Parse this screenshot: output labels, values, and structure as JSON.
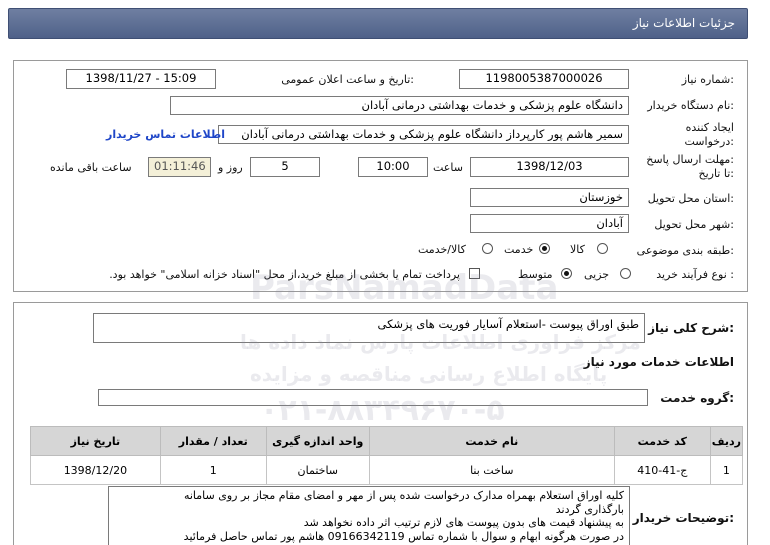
{
  "header": {
    "title": "جزئیات اطلاعات نیاز"
  },
  "form": {
    "need_number_label": "شماره نیاز:",
    "need_number": "1198005387000026",
    "announce_label": "تاریخ و ساعت اعلان عمومی:",
    "announce_value": "1398/11/27 - 15:09",
    "buyer_label": "نام دستگاه خریدار:",
    "buyer_value": "دانشگاه علوم پزشکی و خدمات بهداشتی درمانی آبادان",
    "creator_label_1": "ایجاد کننده",
    "creator_label_2": "درخواست:",
    "creator_value": "سمیر هاشم پور کارپرداز دانشگاه علوم پزشکی و خدمات بهداشتی درمانی آبادان",
    "contact_link": "اطلاعات تماس خریدار",
    "deadline_label_1": "مهلت ارسال پاسخ:",
    "deadline_label_2": "تا تاریخ:",
    "deadline_date": "1398/12/03",
    "time_label": "ساعت",
    "deadline_time": "10:00",
    "days_value": "5",
    "days_label": "روز و",
    "remaining_value": "01:11:46",
    "remaining_label": "ساعت باقی مانده",
    "province_label": "استان محل تحویل:",
    "province_value": "خوزستان",
    "city_label": "شهر محل تحویل:",
    "city_value": "آبادان",
    "category_label": "طبقه بندی موضوعی:",
    "category_options": [
      "کالا",
      "خدمت",
      "کالا/خدمت"
    ],
    "category_selected": "خدمت",
    "process_label": "نوع فرآیند خرید :",
    "process_options": [
      "جزیی",
      "متوسط"
    ],
    "process_selected": "متوسط",
    "payment_note": "پرداخت تمام یا بخشی از مبلغ خرید،از محل \"اسناد خزانه اسلامی\" خواهد بود."
  },
  "summary": {
    "label": "شرح کلی نیاز:",
    "value": "طبق اوراق پیوست -استعلام  آسایار فوریت های پزشکی",
    "services_heading": "اطلاعات خدمات مورد نیاز",
    "group_label": "گروه خدمت:",
    "group_value": ""
  },
  "table": {
    "headers": [
      "ردیف",
      "کد خدمت",
      "نام خدمت",
      "واحد اندازه گیری",
      "تعداد / مقدار",
      "تاریخ نیاز"
    ],
    "rows": [
      [
        "1",
        "ج-41-410",
        "ساخت بنا",
        "ساختمان",
        "1",
        "1398/12/20"
      ]
    ]
  },
  "notes": {
    "label": "توضیحات خریدار:",
    "lines": [
      "کلیه اوراق استعلام بهمراه مدارک درخواست شده پس از مهر و امضای مقام مجاز بر روی سامانه",
      "بارگذاری گردند",
      "به پیشنهاد قیمت های بدون پیوست های لازم ترتیب اثر داده نخواهد شد",
      "در صورت هرگونه ابهام و سوال با شماره تماس 09166342119 هاشم پور تماس حاصل فرمائید"
    ]
  },
  "watermark": {
    "name": "ParsNamadData",
    "line1": "مرکز فراوری اطلاعات پارس نماد داده ها",
    "line2": "پایگاه اطلاع رسانی مناقصه و مزایده",
    "phone": "۰۲۱-۸۸۳۴۹۶۷۰-۵"
  },
  "colors": {
    "header_bg": "#5a6b93",
    "link": "#1f46c8",
    "table_header": "#d6d6d6"
  }
}
